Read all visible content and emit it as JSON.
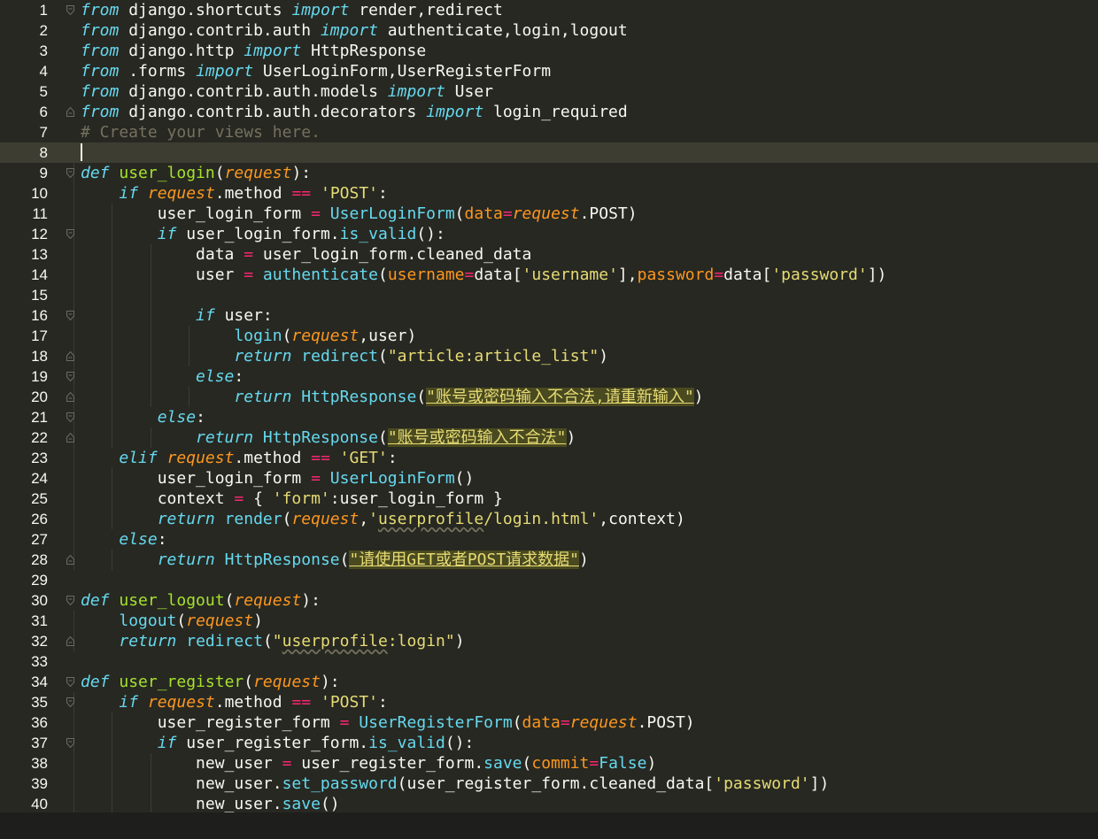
{
  "editor": {
    "theme_colors": {
      "background": "#272822",
      "keyword": "#66D9EF",
      "operator": "#F92672",
      "string": "#E6DB74",
      "parameter": "#FD971F",
      "function": "#A6E22E",
      "comment": "#75715E",
      "text": "#F8F8F2"
    },
    "current_line": 8,
    "lines": [
      {
        "n": "1",
        "fold": "open",
        "tokens": [
          [
            "kw",
            "from"
          ],
          [
            "txt",
            " django.shortcuts "
          ],
          [
            "kw",
            "import"
          ],
          [
            "txt",
            " render,redirect"
          ]
        ]
      },
      {
        "n": "2",
        "tokens": [
          [
            "kw",
            "from"
          ],
          [
            "txt",
            " django.contrib.auth "
          ],
          [
            "kw",
            "import"
          ],
          [
            "txt",
            " authenticate,login,logout"
          ]
        ]
      },
      {
        "n": "3",
        "tokens": [
          [
            "kw",
            "from"
          ],
          [
            "txt",
            " django.http "
          ],
          [
            "kw",
            "import"
          ],
          [
            "txt",
            " HttpResponse"
          ]
        ]
      },
      {
        "n": "4",
        "tokens": [
          [
            "kw",
            "from"
          ],
          [
            "txt",
            " .forms "
          ],
          [
            "kw",
            "import"
          ],
          [
            "txt",
            " UserLoginForm,UserRegisterForm"
          ]
        ]
      },
      {
        "n": "5",
        "tokens": [
          [
            "kw",
            "from"
          ],
          [
            "txt",
            " django.contrib.auth.models "
          ],
          [
            "kw",
            "import"
          ],
          [
            "txt",
            " User"
          ]
        ]
      },
      {
        "n": "6",
        "fold": "close",
        "tokens": [
          [
            "kw",
            "from"
          ],
          [
            "txt",
            " django.contrib.auth.decorators "
          ],
          [
            "kw",
            "import"
          ],
          [
            "txt",
            " login_required"
          ]
        ]
      },
      {
        "n": "7",
        "tokens": [
          [
            "cm",
            "# Create your views here."
          ]
        ]
      },
      {
        "n": "8",
        "tokens": []
      },
      {
        "n": "9",
        "fold": "open",
        "tokens": [
          [
            "kw",
            "def"
          ],
          [
            "txt",
            " "
          ],
          [
            "fn",
            "user_login"
          ],
          [
            "txt",
            "("
          ],
          [
            "self",
            "request"
          ],
          [
            "txt",
            "):"
          ]
        ]
      },
      {
        "n": "10",
        "tokens": [
          [
            "txt",
            "    "
          ],
          [
            "kw",
            "if"
          ],
          [
            "txt",
            " "
          ],
          [
            "self",
            "request"
          ],
          [
            "txt",
            ".method "
          ],
          [
            "op",
            "=="
          ],
          [
            "txt",
            " "
          ],
          [
            "str",
            "'POST'"
          ],
          [
            "txt",
            ":"
          ]
        ]
      },
      {
        "n": "11",
        "tokens": [
          [
            "txt",
            "        user_login_form "
          ],
          [
            "op",
            "="
          ],
          [
            "txt",
            " "
          ],
          [
            "call",
            "UserLoginForm"
          ],
          [
            "txt",
            "("
          ],
          [
            "arg",
            "data"
          ],
          [
            "op",
            "="
          ],
          [
            "self",
            "request"
          ],
          [
            "txt",
            ".POST)"
          ]
        ]
      },
      {
        "n": "12",
        "fold": "open",
        "tokens": [
          [
            "txt",
            "        "
          ],
          [
            "kw",
            "if"
          ],
          [
            "txt",
            " user_login_form."
          ],
          [
            "call",
            "is_valid"
          ],
          [
            "txt",
            "():"
          ]
        ]
      },
      {
        "n": "13",
        "tokens": [
          [
            "txt",
            "            data "
          ],
          [
            "op",
            "="
          ],
          [
            "txt",
            " user_login_form.cleaned_data"
          ]
        ]
      },
      {
        "n": "14",
        "tokens": [
          [
            "txt",
            "            user "
          ],
          [
            "op",
            "="
          ],
          [
            "txt",
            " "
          ],
          [
            "call",
            "authenticate"
          ],
          [
            "txt",
            "("
          ],
          [
            "arg",
            "username"
          ],
          [
            "op",
            "="
          ],
          [
            "txt",
            "data["
          ],
          [
            "str",
            "'username'"
          ],
          [
            "txt",
            "],"
          ],
          [
            "arg",
            "password"
          ],
          [
            "op",
            "="
          ],
          [
            "txt",
            "data["
          ],
          [
            "str",
            "'password'"
          ],
          [
            "txt",
            "])"
          ]
        ]
      },
      {
        "n": "15",
        "tokens": []
      },
      {
        "n": "16",
        "fold": "open",
        "tokens": [
          [
            "txt",
            "            "
          ],
          [
            "kw",
            "if"
          ],
          [
            "txt",
            " user:"
          ]
        ]
      },
      {
        "n": "17",
        "tokens": [
          [
            "txt",
            "                "
          ],
          [
            "call",
            "login"
          ],
          [
            "txt",
            "("
          ],
          [
            "self",
            "request"
          ],
          [
            "txt",
            ",user)"
          ]
        ]
      },
      {
        "n": "18",
        "fold": "close",
        "tokens": [
          [
            "txt",
            "                "
          ],
          [
            "kw",
            "return"
          ],
          [
            "txt",
            " "
          ],
          [
            "call",
            "redirect"
          ],
          [
            "txt",
            "("
          ],
          [
            "str",
            "\"article:article_list\""
          ],
          [
            "txt",
            ")"
          ]
        ]
      },
      {
        "n": "19",
        "fold": "open",
        "tokens": [
          [
            "txt",
            "            "
          ],
          [
            "kw",
            "else"
          ],
          [
            "txt",
            ":"
          ]
        ]
      },
      {
        "n": "20",
        "fold": "close",
        "tokens": [
          [
            "txt",
            "                "
          ],
          [
            "kw",
            "return"
          ],
          [
            "txt",
            " "
          ],
          [
            "call",
            "HttpResponse"
          ],
          [
            "txt",
            "("
          ],
          [
            "str-hl",
            "\"账号或密码输入不合法,请重新输入\""
          ],
          [
            "txt",
            ")"
          ]
        ]
      },
      {
        "n": "21",
        "fold": "open",
        "tokens": [
          [
            "txt",
            "        "
          ],
          [
            "kw",
            "else"
          ],
          [
            "txt",
            ":"
          ]
        ]
      },
      {
        "n": "22",
        "fold": "close",
        "tokens": [
          [
            "txt",
            "            "
          ],
          [
            "kw",
            "return"
          ],
          [
            "txt",
            " "
          ],
          [
            "call",
            "HttpResponse"
          ],
          [
            "txt",
            "("
          ],
          [
            "str-hl",
            "\"账号或密码输入不合法\""
          ],
          [
            "txt",
            ")"
          ]
        ]
      },
      {
        "n": "23",
        "tokens": [
          [
            "txt",
            "    "
          ],
          [
            "kw",
            "elif"
          ],
          [
            "txt",
            " "
          ],
          [
            "self",
            "request"
          ],
          [
            "txt",
            ".method "
          ],
          [
            "op",
            "=="
          ],
          [
            "txt",
            " "
          ],
          [
            "str",
            "'GET'"
          ],
          [
            "txt",
            ":"
          ]
        ]
      },
      {
        "n": "24",
        "tokens": [
          [
            "txt",
            "        user_login_form "
          ],
          [
            "op",
            "="
          ],
          [
            "txt",
            " "
          ],
          [
            "call",
            "UserLoginForm"
          ],
          [
            "txt",
            "()"
          ]
        ]
      },
      {
        "n": "25",
        "tokens": [
          [
            "txt",
            "        context "
          ],
          [
            "op",
            "="
          ],
          [
            "txt",
            " { "
          ],
          [
            "str",
            "'form'"
          ],
          [
            "txt",
            ":user_login_form }"
          ]
        ]
      },
      {
        "n": "26",
        "tokens": [
          [
            "txt",
            "        "
          ],
          [
            "kw",
            "return"
          ],
          [
            "txt",
            " "
          ],
          [
            "call",
            "render"
          ],
          [
            "txt",
            "("
          ],
          [
            "self",
            "request"
          ],
          [
            "txt",
            ","
          ],
          [
            "str",
            "'"
          ],
          [
            "str squig",
            "userprofile"
          ],
          [
            "str",
            "/login.html'"
          ],
          [
            "txt",
            ",context)"
          ]
        ]
      },
      {
        "n": "27",
        "tokens": [
          [
            "txt",
            "    "
          ],
          [
            "kw",
            "else"
          ],
          [
            "txt",
            ":"
          ]
        ]
      },
      {
        "n": "28",
        "fold": "close",
        "tokens": [
          [
            "txt",
            "        "
          ],
          [
            "kw",
            "return"
          ],
          [
            "txt",
            " "
          ],
          [
            "call",
            "HttpResponse"
          ],
          [
            "txt",
            "("
          ],
          [
            "str-hl",
            "\"请使用GET或者POST请求数据\""
          ],
          [
            "txt",
            ")"
          ]
        ]
      },
      {
        "n": "29",
        "tokens": []
      },
      {
        "n": "30",
        "fold": "open",
        "tokens": [
          [
            "kw",
            "def"
          ],
          [
            "txt",
            " "
          ],
          [
            "fn",
            "user_logout"
          ],
          [
            "txt",
            "("
          ],
          [
            "self",
            "request"
          ],
          [
            "txt",
            "):"
          ]
        ]
      },
      {
        "n": "31",
        "tokens": [
          [
            "txt",
            "    "
          ],
          [
            "call",
            "logout"
          ],
          [
            "txt",
            "("
          ],
          [
            "self",
            "request"
          ],
          [
            "txt",
            ")"
          ]
        ]
      },
      {
        "n": "32",
        "fold": "close",
        "tokens": [
          [
            "txt",
            "    "
          ],
          [
            "kw",
            "return"
          ],
          [
            "txt",
            " "
          ],
          [
            "call",
            "redirect"
          ],
          [
            "txt",
            "("
          ],
          [
            "str",
            "\""
          ],
          [
            "str squig",
            "userprofile"
          ],
          [
            "str",
            ":login\""
          ],
          [
            "txt",
            ")"
          ]
        ]
      },
      {
        "n": "33",
        "tokens": []
      },
      {
        "n": "34",
        "fold": "open",
        "tokens": [
          [
            "kw",
            "def"
          ],
          [
            "txt",
            " "
          ],
          [
            "fn",
            "user_register"
          ],
          [
            "txt",
            "("
          ],
          [
            "self",
            "request"
          ],
          [
            "txt",
            "):"
          ]
        ]
      },
      {
        "n": "35",
        "fold": "open",
        "tokens": [
          [
            "txt",
            "    "
          ],
          [
            "kw",
            "if"
          ],
          [
            "txt",
            " "
          ],
          [
            "self",
            "request"
          ],
          [
            "txt",
            ".method "
          ],
          [
            "op",
            "=="
          ],
          [
            "txt",
            " "
          ],
          [
            "str",
            "'POST'"
          ],
          [
            "txt",
            ":"
          ]
        ]
      },
      {
        "n": "36",
        "tokens": [
          [
            "txt",
            "        user_register_form "
          ],
          [
            "op",
            "="
          ],
          [
            "txt",
            " "
          ],
          [
            "call",
            "UserRegisterForm"
          ],
          [
            "txt",
            "("
          ],
          [
            "arg",
            "data"
          ],
          [
            "op",
            "="
          ],
          [
            "self",
            "request"
          ],
          [
            "txt",
            ".POST)"
          ]
        ]
      },
      {
        "n": "37",
        "fold": "open",
        "tokens": [
          [
            "txt",
            "        "
          ],
          [
            "kw",
            "if"
          ],
          [
            "txt",
            " user_register_form."
          ],
          [
            "call",
            "is_valid"
          ],
          [
            "txt",
            "():"
          ]
        ]
      },
      {
        "n": "38",
        "tokens": [
          [
            "txt",
            "            new_user "
          ],
          [
            "op",
            "="
          ],
          [
            "txt",
            " user_register_form."
          ],
          [
            "call",
            "save"
          ],
          [
            "txt",
            "("
          ],
          [
            "arg",
            "commit"
          ],
          [
            "op",
            "="
          ],
          [
            "call",
            "False"
          ],
          [
            "txt",
            ")"
          ]
        ]
      },
      {
        "n": "39",
        "tokens": [
          [
            "txt",
            "            new_user."
          ],
          [
            "call",
            "set_password"
          ],
          [
            "txt",
            "(user_register_form.cleaned_data["
          ],
          [
            "str",
            "'password'"
          ],
          [
            "txt",
            "])"
          ]
        ]
      },
      {
        "n": "40",
        "tokens": [
          [
            "txt",
            "            new_user."
          ],
          [
            "call",
            "save"
          ],
          [
            "txt",
            "()"
          ]
        ]
      }
    ]
  }
}
